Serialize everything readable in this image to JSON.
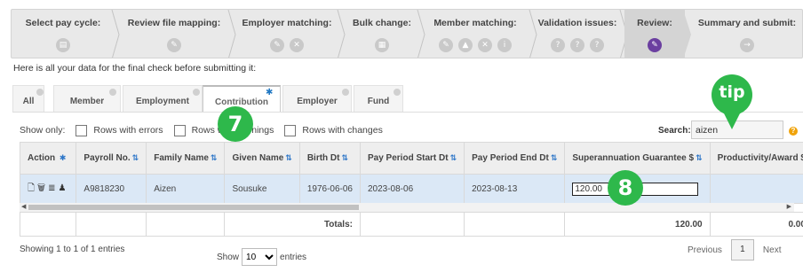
{
  "wizard": {
    "steps": [
      {
        "label": "Select pay cycle:",
        "icons": [
          "file-icon"
        ]
      },
      {
        "label": "Review file mapping:",
        "icons": [
          "map-icon"
        ]
      },
      {
        "label": "Employer matching:",
        "icons": [
          "pencil-icon",
          "close-icon"
        ]
      },
      {
        "label": "Bulk change:",
        "icons": [
          "grid-icon"
        ]
      },
      {
        "label": "Member matching:",
        "icons": [
          "pencil-icon",
          "warning-icon",
          "close-icon",
          "info-icon"
        ]
      },
      {
        "label": "Validation issues:",
        "icons": [
          "help-icon",
          "help-icon",
          "help-icon"
        ]
      },
      {
        "label": "Review:",
        "icons": [
          "edit-icon"
        ],
        "current": true
      },
      {
        "label": "Summary and submit:",
        "icons": [
          "arrow-right-icon"
        ]
      }
    ]
  },
  "intro_text": "Here is all your data for the final check before submitting it:",
  "tabs": [
    "All",
    "Member",
    "Employment",
    "Contribution",
    "Employer",
    "Fund"
  ],
  "active_tab": "Contribution",
  "filters": {
    "show_only_label": "Show only:",
    "options": [
      "Rows with errors",
      "Rows with warnings",
      "Rows with changes"
    ]
  },
  "search": {
    "label": "Search:",
    "value": "aizen"
  },
  "table": {
    "columns": [
      "Action",
      "Payroll No.",
      "Family Name",
      "Given Name",
      "Birth Dt",
      "Pay Period Start Dt",
      "Pay Period End Dt",
      "Superannuation Guarantee $",
      "Productivity/Award $"
    ],
    "rows": [
      {
        "payroll_no": "A9818230",
        "family_name": "Aizen",
        "given_name": "Sousuke",
        "birth_dt": "1976-06-06",
        "start_dt": "2023-08-06",
        "end_dt": "2023-08-13",
        "super_guarantee": "120.00",
        "productivity": ""
      }
    ],
    "totals": {
      "label": "Totals:",
      "super_guarantee": "120.00",
      "productivity": "0.00"
    }
  },
  "footer": {
    "info": "Showing 1 to 1 of 1 entries",
    "show_label": "Show",
    "page_size": "10",
    "entries_label": "entries",
    "previous": "Previous",
    "current_page": "1",
    "next": "Next"
  },
  "callouts": {
    "tip": "tip",
    "seven": "7",
    "eight": "8"
  },
  "colors": {
    "accent": "#2eb84b",
    "row_highlight": "#dbe8f6",
    "sort_icon": "#2d76c8",
    "active_step": "#6b3fa0"
  }
}
